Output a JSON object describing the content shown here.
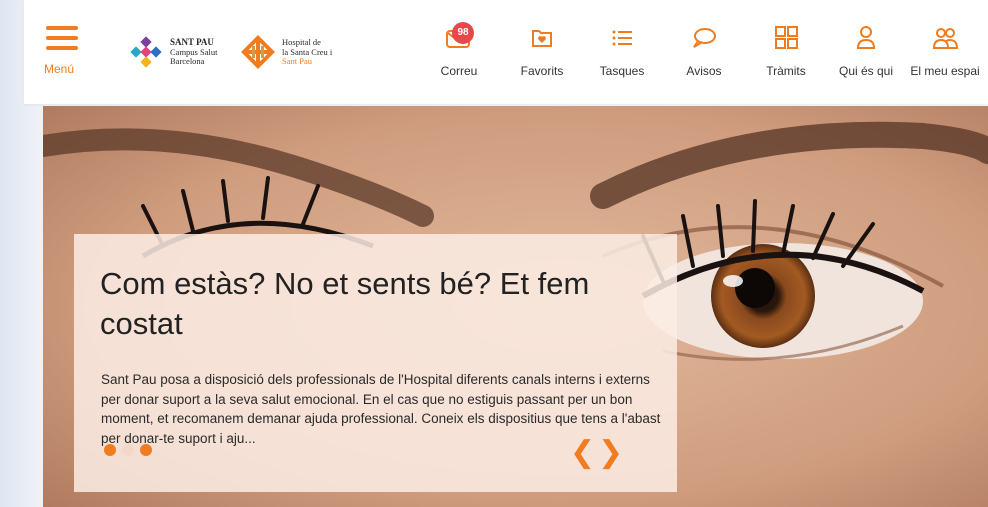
{
  "header": {
    "menu_label": "Menú",
    "logo_sant_pau": {
      "line1": "SANT PAU",
      "line2": "Campus Salut",
      "line3": "Barcelona"
    },
    "logo_hospital": {
      "line1": "Hospital de",
      "line2": "la Santa Creu i",
      "line3": "Sant Pau"
    },
    "nav": [
      {
        "label": "Correu",
        "icon": "mail-icon",
        "badge": "98"
      },
      {
        "label": "Favorits",
        "icon": "favorites-folder-icon"
      },
      {
        "label": "Tasques",
        "icon": "task-list-icon"
      },
      {
        "label": "Avisos",
        "icon": "speech-bubble-icon"
      },
      {
        "label": "Tràmits",
        "icon": "grid-icon"
      },
      {
        "label": "Qui és qui",
        "icon": "person-icon"
      },
      {
        "label": "El meu espai",
        "icon": "people-icon"
      }
    ]
  },
  "hero": {
    "title": "Com estàs? No et sents bé? Et fem costat",
    "text": "Sant Pau posa a disposició dels professionals de l'Hospital diferents canals interns i externs per donar suport a la seva salut emocional. En el cas que no estiguis passant per un bon moment, et recomanem demanar ajuda professional. Coneix els dispositius que tens a l'abast per donar-te suport i aju...",
    "prev_arrow": "❮",
    "next_arrow": "❯",
    "slides_total": 3,
    "slide_active": 1
  },
  "colors": {
    "accent": "#f07c1f",
    "badge": "#e8474c",
    "header_bg": "#ffffff"
  }
}
